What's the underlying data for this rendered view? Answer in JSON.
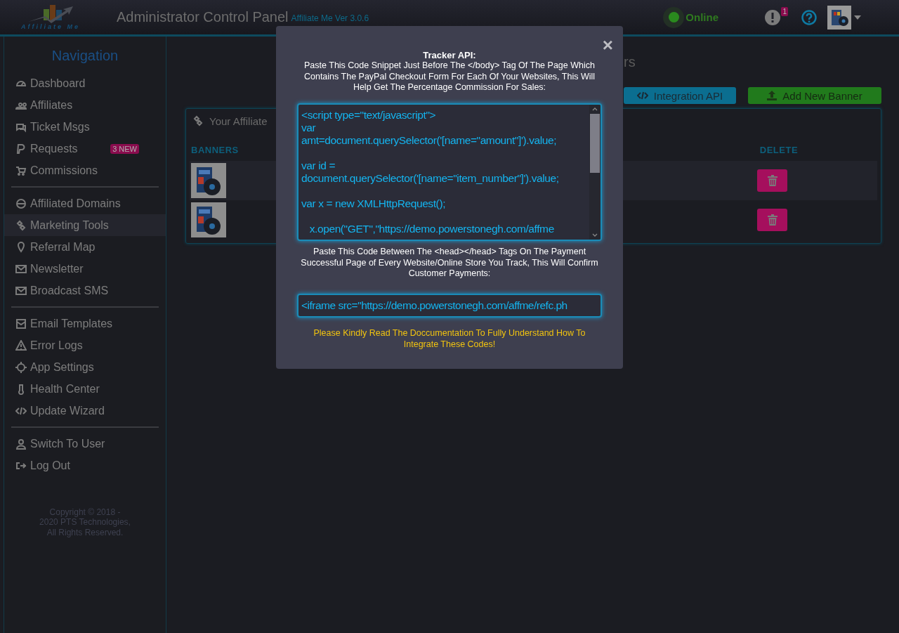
{
  "header": {
    "logo_text": "Affiliate Me",
    "title": "Administrator Control Panel",
    "version": "Affiliate Me Ver 3.0.6",
    "status": {
      "label": "Online",
      "online": true
    },
    "alerts_badge": "1"
  },
  "sidebar": {
    "title": "Navigation",
    "groups": [
      {
        "items": [
          {
            "label": "Dashboard",
            "selected": false
          },
          {
            "label": "Affiliates",
            "selected": false
          },
          {
            "label": "Ticket Msgs",
            "selected": false
          },
          {
            "label": "Requests",
            "selected": false,
            "badge": "3 NEW"
          },
          {
            "label": "Commissions",
            "selected": false
          }
        ]
      },
      {
        "items": [
          {
            "label": "Affiliated Domains",
            "selected": false
          },
          {
            "label": "Marketing Tools",
            "selected": true
          },
          {
            "label": "Referral Map",
            "selected": false
          },
          {
            "label": "Newsletter",
            "selected": false
          },
          {
            "label": "Broadcast SMS",
            "selected": false
          }
        ]
      },
      {
        "items": [
          {
            "label": "Email Templates",
            "selected": false
          },
          {
            "label": "Error Logs",
            "selected": false
          },
          {
            "label": "App Settings",
            "selected": false
          },
          {
            "label": "Health Center",
            "selected": false
          },
          {
            "label": "Update Wizard",
            "selected": false
          }
        ]
      },
      {
        "items": [
          {
            "label": "Switch To User",
            "selected": false
          },
          {
            "label": "Log Out",
            "selected": false
          }
        ]
      }
    ],
    "copyright": "Copyright © 2018 - 2020 PTS Technologies, All Rights Reserved."
  },
  "page": {
    "heading_tail": "rs",
    "buttons": [
      "Integration API",
      "Add New Banner"
    ],
    "card": {
      "title": "Your Affiliate",
      "columns": [
        "BANNERS",
        "DELETE"
      ],
      "rows": [
        {
          "banner": {
            "kind": "picture"
          }
        },
        {
          "banner": {
            "kind": "picture"
          }
        }
      ]
    }
  },
  "modal": {
    "title": "Tracker API:",
    "intro": "Paste This Code Snippet Just Before The </body> Tag Of The Page Which Contains The PayPal Checkout Form For Each Of Your Websites, This Will Help Get The Percentage Commission For Sales:",
    "code_blocks": [
      [
        "<script type=\"text/javascript\">",
        "var",
        "amt=document.querySelector('[name=\"amount\"]').value;"
      ],
      [
        "var id =",
        "document.querySelector('[name=\"item_number\"]').value;"
      ],
      [
        "var x = new XMLHttpRequest();"
      ],
      [
        "   x.open(\"GET\",\"https://demo.powerstonegh.com/affme"
      ]
    ],
    "second_intro": "Paste This Code Between The <head></head> Tags On The Payment Successful Page of Every Website/Online Store You Track, This Will Confirm Customer Payments:",
    "iframe_code": "<iframe src=\"https://demo.powerstonegh.com/affme/refc.ph",
    "note": "Please Kindly Read The Doccumentation To Fully Understand How To Integrate These Codes!",
    "close": "×"
  }
}
